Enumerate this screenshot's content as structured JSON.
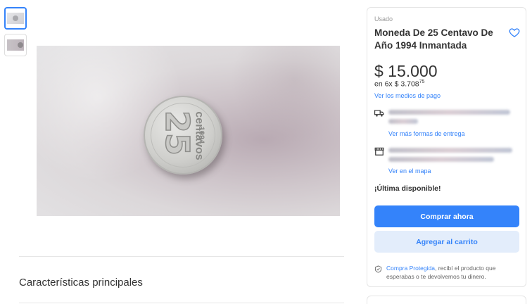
{
  "product": {
    "condition": "Usado",
    "title": "Moneda De 25 Centavo De Año 1994 Inmantada",
    "price": "$ 15.000",
    "installments_prefix": "en 6x $ 3.708",
    "installments_cents": "75",
    "payment_link": "Ver los medios de pago"
  },
  "shipping": {
    "delivery_link": "Ver más formas de entrega",
    "pickup_link": "Ver en el mapa"
  },
  "stock": {
    "label": "¡Última disponible!"
  },
  "actions": {
    "buy_label": "Comprar ahora",
    "cart_label": "Agregar al carrito"
  },
  "protection": {
    "highlight": "Compra Protegida",
    "text": ", recibí el producto que esperabas o te devolvemos tu dinero."
  },
  "sections": {
    "main_features": "Características principales"
  },
  "photo": {
    "coin_number": "25",
    "coin_word": "centavos",
    "coin_year": "1994"
  },
  "colors": {
    "accent": "#3483fa",
    "secondary_bg": "#e3edfb"
  }
}
